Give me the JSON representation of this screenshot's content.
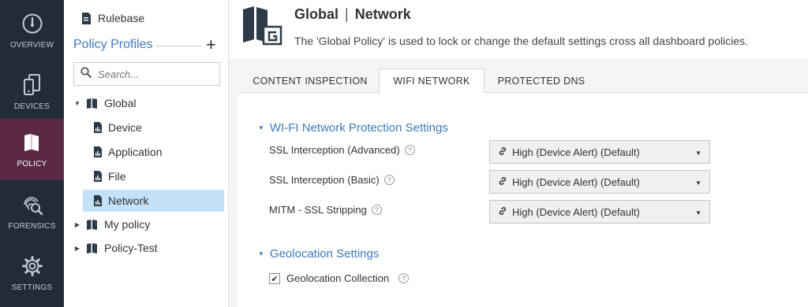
{
  "nav": {
    "items": [
      {
        "label": "OVERVIEW",
        "icon": "gauge-icon",
        "active": false
      },
      {
        "label": "DEVICES",
        "icon": "devices-icon",
        "active": false
      },
      {
        "label": "POLICY",
        "icon": "policy-book-icon",
        "active": true
      },
      {
        "label": "FORENSICS",
        "icon": "fingerprint-search-icon",
        "active": false
      },
      {
        "label": "SETTINGS",
        "icon": "gear-icon",
        "active": false
      }
    ]
  },
  "tree": {
    "rulebase_label": "Rulebase",
    "profiles_title": "Policy Profiles",
    "add_symbol": "+",
    "search_placeholder": "Search...",
    "profiles": [
      {
        "label": "Global",
        "expanded": true,
        "children": [
          "Device",
          "Application",
          "File",
          "Network"
        ]
      },
      {
        "label": "My policy",
        "expanded": false
      },
      {
        "label": "Policy-Test",
        "expanded": false
      }
    ],
    "selected": "Network"
  },
  "header": {
    "title": "Global",
    "separator": "|",
    "subtitle": "Network",
    "description": "The 'Global Policy' is used to lock or change the default settings cross all dashboard policies."
  },
  "tabs": [
    {
      "label": "CONTENT INSPECTION",
      "active": false
    },
    {
      "label": "WIFI NETWORK",
      "active": true
    },
    {
      "label": "PROTECTED DNS",
      "active": false
    }
  ],
  "sections": {
    "wifi": {
      "title": "WI-FI Network Protection Settings",
      "settings": [
        {
          "label": "SSL Interception (Advanced)",
          "value": "High (Device Alert) (Default)"
        },
        {
          "label": "SSL Interception (Basic)",
          "value": "High (Device Alert) (Default)"
        },
        {
          "label": "MITM - SSL Stripping",
          "value": "High (Device Alert) (Default)"
        }
      ]
    },
    "geo": {
      "title": "Geolocation Settings",
      "checkbox_label": "Geolocation Collection",
      "checked": true
    }
  },
  "colors": {
    "nav_bg": "#222b38",
    "nav_active": "#5a2a45",
    "accent_blue": "#3d7ab8",
    "selection": "#c5e1f7"
  }
}
